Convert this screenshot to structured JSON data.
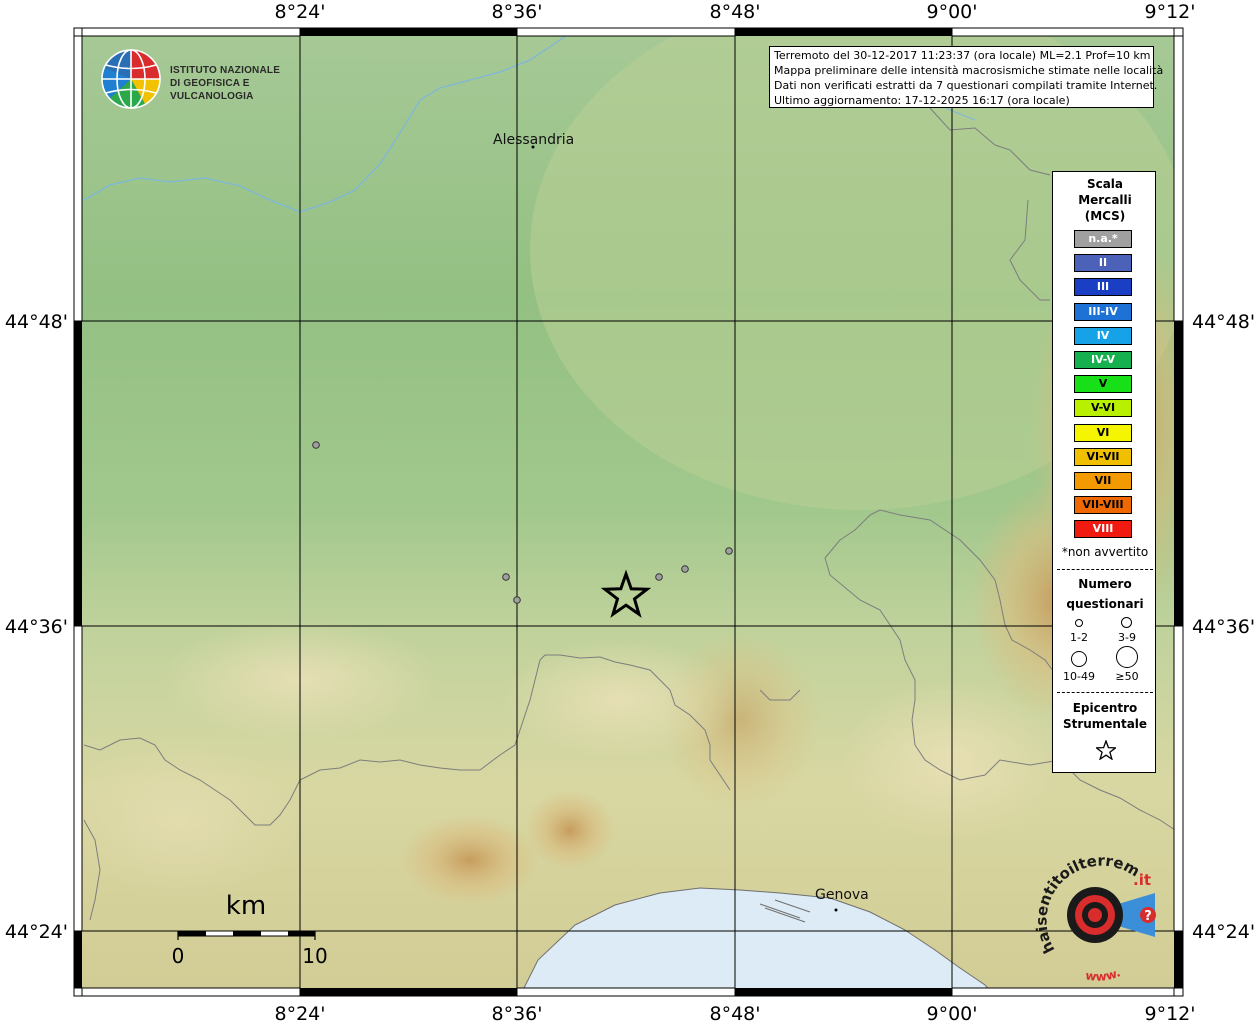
{
  "map": {
    "lon_labels": [
      "8°24'",
      "8°36'",
      "8°48'",
      "9°00'",
      "9°12'"
    ],
    "lat_labels": [
      "44°48'",
      "44°36'",
      "44°24'"
    ],
    "cities": [
      {
        "name": "Alessandria"
      },
      {
        "name": "Genova"
      }
    ],
    "scale_bar": {
      "unit": "km",
      "start_label": "0",
      "end_label": "10"
    },
    "epicenter": {
      "symbol": "star"
    },
    "intensity_points": [
      {
        "id": 1,
        "category": "n.a."
      },
      {
        "id": 2,
        "category": "n.a."
      },
      {
        "id": 3,
        "category": "n.a."
      },
      {
        "id": 4,
        "category": "n.a."
      },
      {
        "id": 5,
        "category": "n.a."
      },
      {
        "id": 6,
        "category": "n.a."
      },
      {
        "id": 7,
        "category": "n.a."
      }
    ]
  },
  "logo": {
    "line1": "ISTITUTO NAZIONALE",
    "line2": "DI GEOFISICA E VULCANOLOGIA"
  },
  "info": {
    "line1": "Terremoto del 30-12-2017 11:23:37 (ora locale) ML=2.1 Prof=10 km",
    "line2": "Mappa preliminare delle intensità macrosismiche stimate nelle località",
    "line3": "Dati non verificati estratti da 7 questionari compilati tramite Internet.",
    "line4": "Ultimo aggiornamento: 17-12-2025 16:17 (ora locale)"
  },
  "legend": {
    "title_line1": "Scala",
    "title_line2": "Mercalli",
    "title_line3": "(MCS)",
    "scale": [
      {
        "label": "n.a.*",
        "color": "#a0a0a0"
      },
      {
        "label": "II",
        "color": "#4b62b8"
      },
      {
        "label": "III",
        "color": "#1a3fc4"
      },
      {
        "label": "III-IV",
        "color": "#1e72d6"
      },
      {
        "label": "IV",
        "color": "#16a2e6"
      },
      {
        "label": "IV-V",
        "color": "#17b04e"
      },
      {
        "label": "V",
        "color": "#18e018"
      },
      {
        "label": "V-VI",
        "color": "#b8f000"
      },
      {
        "label": "VI",
        "color": "#f5f500"
      },
      {
        "label": "VI-VII",
        "color": "#f0c000"
      },
      {
        "label": "VII",
        "color": "#f29a00"
      },
      {
        "label": "VII-VIII",
        "color": "#f06800"
      },
      {
        "label": "VIII",
        "color": "#f01a10"
      }
    ],
    "not_felt_note": "*non avvertito",
    "count_title_line1": "Numero",
    "count_title_line2": "questionari",
    "count_sizes": [
      {
        "label": "1-2"
      },
      {
        "label": "3-9"
      },
      {
        "label": "10-49"
      },
      {
        "label": "≥50"
      }
    ],
    "epicenter_title_line1": "Epicentro",
    "epicenter_title_line2": "Strumentale"
  },
  "hst_logo": {
    "text_main": "haisentitoilterremoto",
    "text_url": "www.",
    "text_tld": ".it"
  }
}
